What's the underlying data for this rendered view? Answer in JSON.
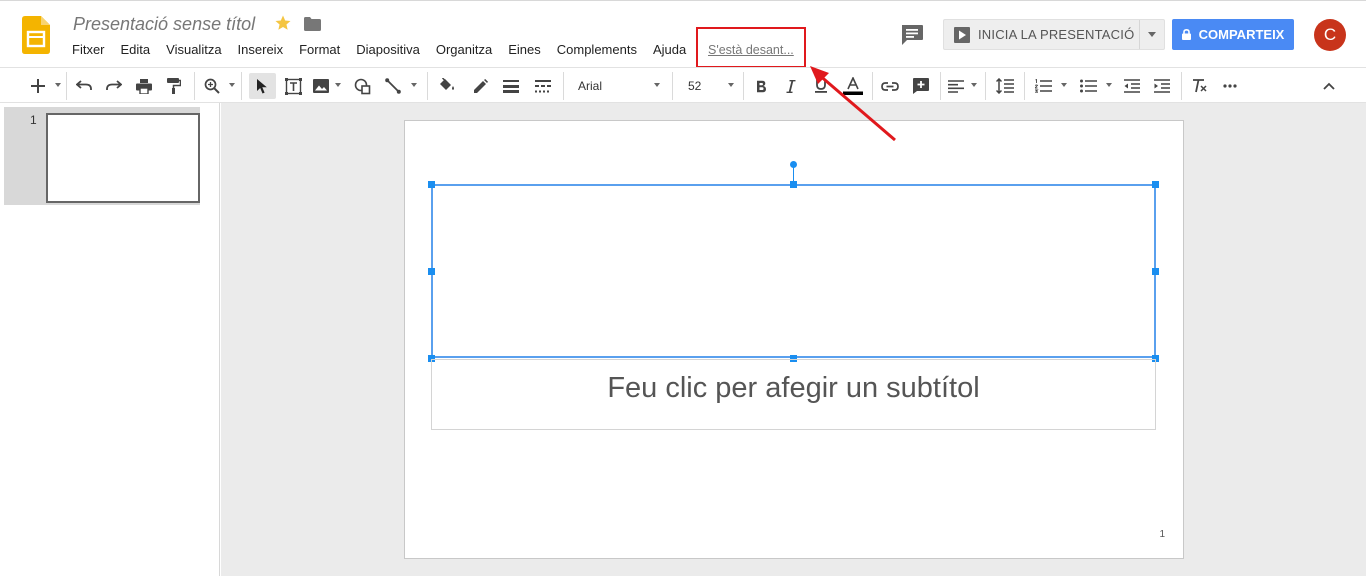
{
  "header": {
    "doc_title": "Presentació sense títol",
    "menu": [
      "Fitxer",
      "Edita",
      "Visualitza",
      "Insereix",
      "Format",
      "Diapositiva",
      "Organitza",
      "Eines",
      "Complements",
      "Ajuda"
    ],
    "saving_status": "S'està desant...",
    "present_label": "INICIA LA PRESENTACIÓ",
    "share_label": "COMPARTEIX",
    "avatar_initial": "C"
  },
  "toolbar": {
    "font_name": "Arial",
    "font_size": "52"
  },
  "filmstrip": {
    "slides": [
      {
        "number": "1"
      }
    ]
  },
  "slide": {
    "subtitle_placeholder": "Feu clic per afegir un subtítol",
    "page_number": "1"
  },
  "colors": {
    "accent_blue": "#4a8af4",
    "selection_blue": "#1a8ef0",
    "annotation_red": "#e0191d",
    "avatar_red": "#c8341b",
    "logo_yellow": "#f4b400"
  }
}
